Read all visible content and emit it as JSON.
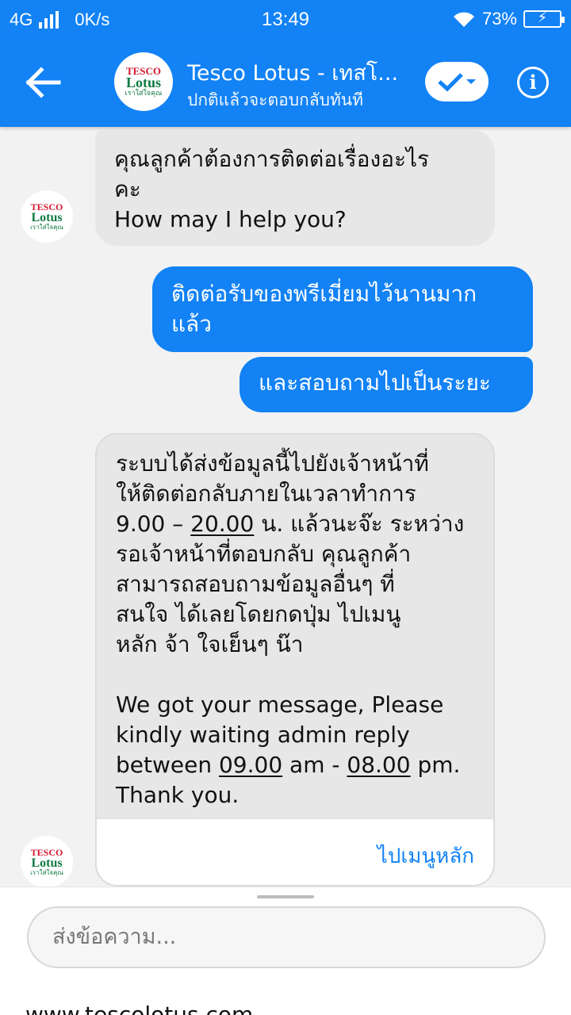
{
  "status_bar": {
    "network": "4G",
    "speed": "0K/s",
    "time": "13:49",
    "battery": "73%"
  },
  "header": {
    "title": "Tesco Lotus - เทสโ...",
    "subtitle": "ปกติแล้วจะตอบกลับทันที"
  },
  "logo": {
    "brand_top": "TESCO",
    "brand_bottom": "Lotus",
    "tagline": "เราใส่ใจคุณ"
  },
  "messages": {
    "m1": {
      "line1": "คุณลูกค้าต้องการติดต่อเรื่องอะไร",
      "line2": "คะ",
      "line3": "How may I help you?"
    },
    "m2": {
      "line1": "ติดต่อรับของพรีเมี่ยมไว้นานมาก",
      "line2": "แล้ว"
    },
    "m3": {
      "line1": "และสอบถามไปเป็นระยะ"
    },
    "card": {
      "th1": "ระบบได้ส่งข้อมูลนี้ไปยังเจ้าหน้าที่",
      "th2": "ให้ติดต่อกลับภายในเวลาทำการ",
      "th3_a": "9.00 – ",
      "th3_b": "20.00",
      "th3_c": " น. แล้วนะจ๊ะ ระหว่าง",
      "th4": "รอเจ้าหน้าที่ตอบกลับ คุณลูกค้า",
      "th5": "สามารถสอบถามข้อมูลอื่นๆ ที่",
      "th6": "สนใจ ได้เลยโดยกดปุ่ม ไปเมนู",
      "th7": "หลัก จ้า ใจเย็นๆ น๊า",
      "en1": "We got your message, Please",
      "en2": "kindly waiting admin reply",
      "en3_a": "between ",
      "en3_b": "09.00",
      "en3_c": " am - ",
      "en3_d": "08.00",
      "en3_e": " pm.",
      "en4": "Thank you.",
      "button": "ไปเมนูหลัก"
    }
  },
  "composer": {
    "placeholder": "ส่งข้อความ...",
    "footer": "www.tescolotus.com"
  },
  "colors": {
    "brand_blue": "#1282f5",
    "incoming_bubble": "#e7e7e7"
  }
}
